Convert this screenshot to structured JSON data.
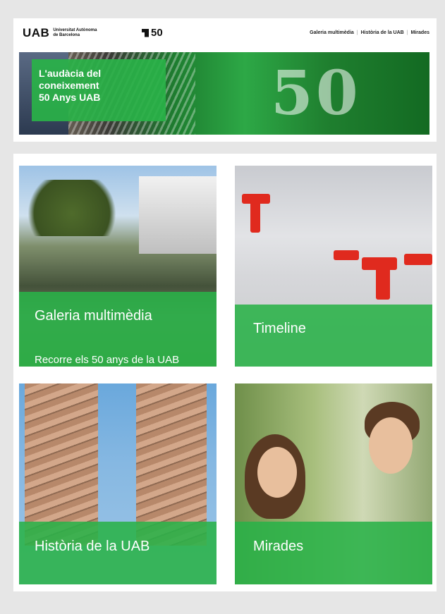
{
  "header": {
    "logo_text": "UAB",
    "logo_sub_line1": "Universitat Autònoma",
    "logo_sub_line2": "de Barcelona",
    "anniversary_mark": "50",
    "nav": [
      "Galeria multimèdia",
      "Història de la UAB",
      "Mirades"
    ]
  },
  "banner": {
    "line1": "L'audàcia del",
    "line2": "coneixement",
    "line3": "50 Anys UAB",
    "big_number": "50"
  },
  "tiles": {
    "galeria": {
      "title": "Galeria multimèdia",
      "subtitle": "Recorre els 50 anys de la UAB"
    },
    "timeline": {
      "title": "Timeline"
    },
    "historia": {
      "title": "Història de la UAB"
    },
    "mirades": {
      "title": "Mirades"
    }
  },
  "colors": {
    "accent_green": "#29b248",
    "page_bg": "#e6e6e6"
  }
}
